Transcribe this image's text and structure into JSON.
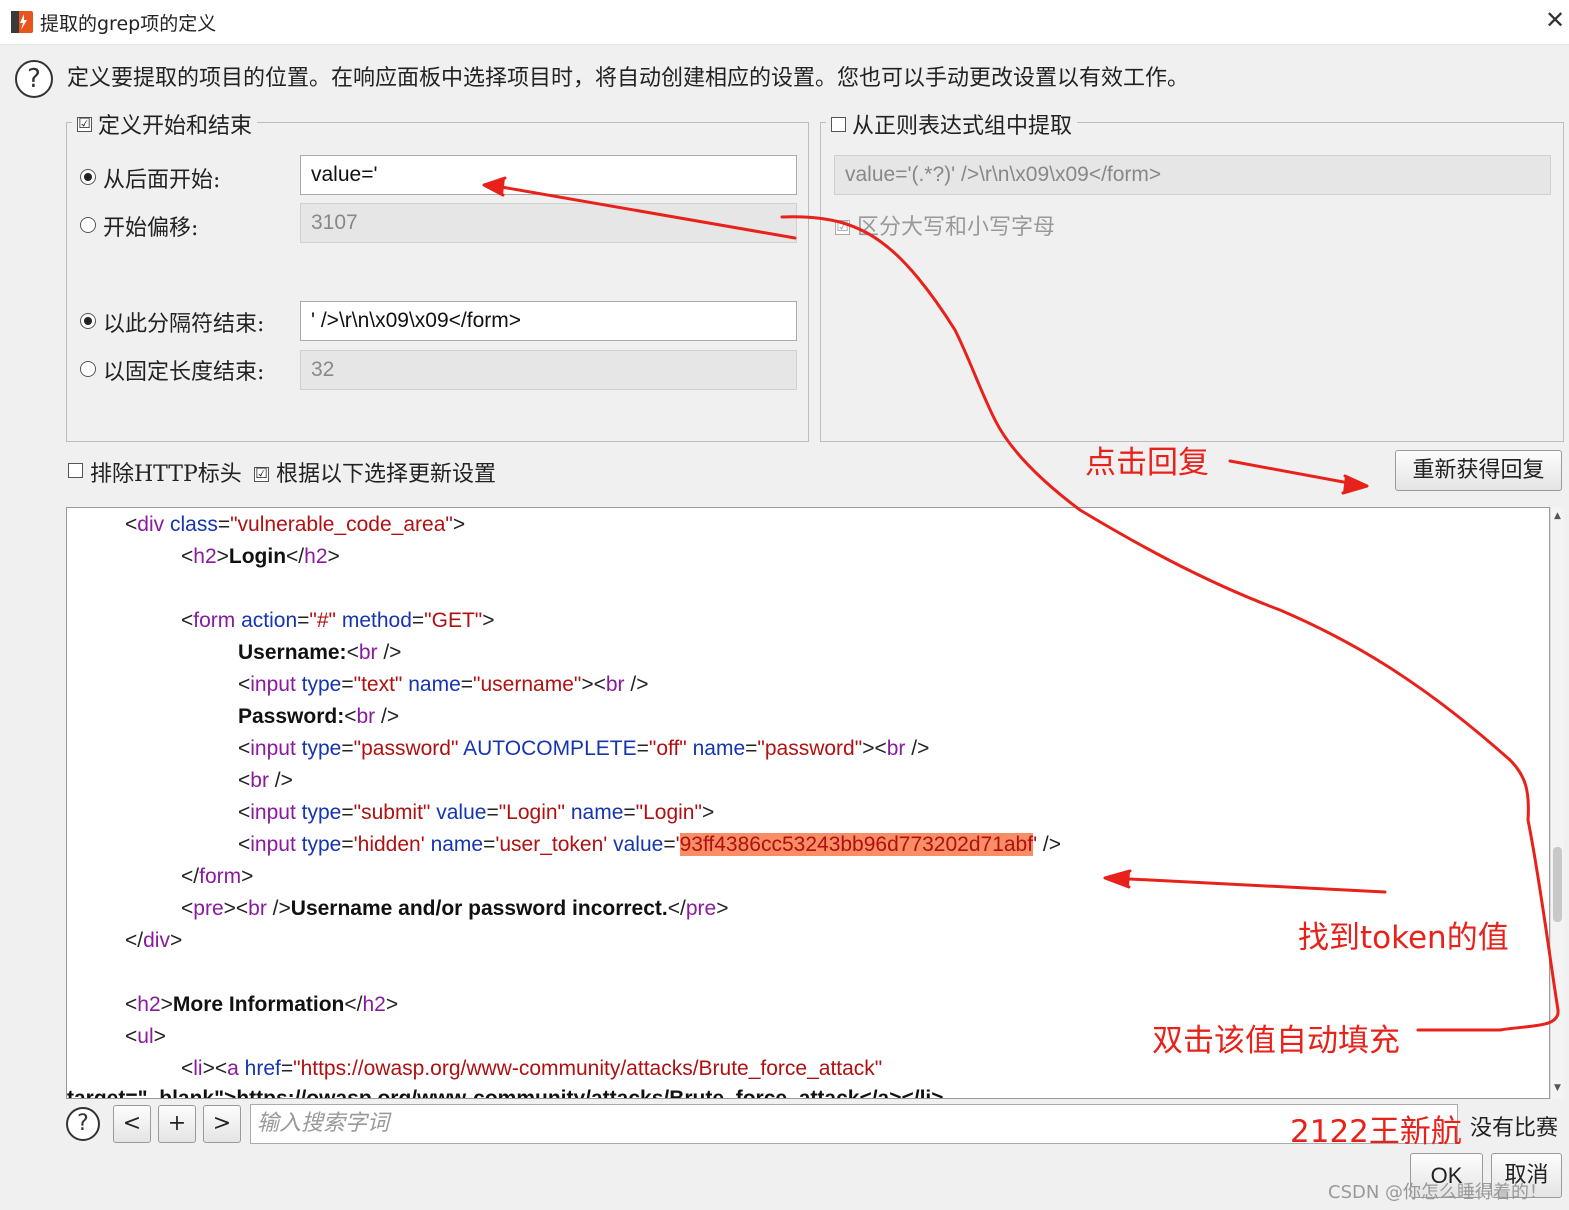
{
  "window": {
    "title": "提取的grep项的定义",
    "close_glyph": "✕"
  },
  "description": "定义要提取的项目的位置。在响应面板中选择项目时，将自动创建相应的设置。您也可以手动更改设置以有效工作。",
  "help_glyph": "?",
  "start_end_group": {
    "label": "定义开始和结束",
    "checked": true,
    "start_after_label": "从后面开始:",
    "start_after_value": "value='",
    "start_offset_label": "开始偏移:",
    "start_offset_value": "3107",
    "end_delimiter_label": "以此分隔符结束:",
    "end_delimiter_value": "' />\\r\\n\\x09\\x09</form>",
    "end_length_label": "以固定长度结束:",
    "end_length_value": "32"
  },
  "regex_group": {
    "label": "从正则表达式组中提取",
    "checked": false,
    "regex_value": "value='(.*?)' />\\r\\n\\x09\\x09</form>",
    "case_label": "区分大写和小写字母"
  },
  "options": {
    "exclude_headers_label": "排除HTTP标头",
    "update_config_label": "根据以下选择更新设置",
    "refetch_button": "重新获得回复"
  },
  "code": {
    "l1_tag": "div",
    "l1_attr": "class",
    "l1_val": "\"vulnerable_code_area\"",
    "l2_tag": "h2",
    "l2_text": "Login",
    "l3_tag": "form",
    "l3_attr1": "action",
    "l3_val1": "\"#\"",
    "l3_attr2": "method",
    "l3_val2": "\"GET\"",
    "l4_text": "Username:",
    "br": "br",
    "input": "input",
    "type": "type",
    "name": "name",
    "value": "value",
    "autocomplete": "AUTOCOMPLETE",
    "l5_type": "\"text\"",
    "l5_name": "\"username\"",
    "l6_text": "Password:",
    "l7_type": "\"password\"",
    "l7_auto": "\"off\"",
    "l7_name": "\"password\"",
    "l9_type": "\"submit\"",
    "l9_value": "\"Login\"",
    "l9_name": "\"Login\"",
    "l10_type": "'hidden'",
    "l10_name": "'user_token'",
    "l10_token": "93ff4386cc53243bb96d773202d71abf",
    "pre": "pre",
    "l12_text": "Username and/or password incorrect.",
    "l15_text": "More Information",
    "ul": "ul",
    "li": "li",
    "a": "a",
    "href": "href",
    "l17_href": "\"https://owasp.org/www-community/attacks/Brute_force_attack\"",
    "l18_partial": "target=\"_blank\">https://owasp.org/www-community/attacks/Brute_force_attack</a></li>"
  },
  "search": {
    "prev": "<",
    "add": "+",
    "next": ">",
    "placeholder": "输入搜索字词",
    "status": "没有比赛"
  },
  "buttons": {
    "ok": "OK",
    "cancel": "取消"
  },
  "annotations": {
    "click_reply": "点击回复",
    "find_token": "找到token的值",
    "double_click": "双击该值自动填充",
    "author": "2122王新航"
  },
  "watermark": "CSDN @你怎么睡得着的！",
  "colors": {
    "annotation_red": "#e8221a",
    "token_highlight": "#f98e66"
  }
}
